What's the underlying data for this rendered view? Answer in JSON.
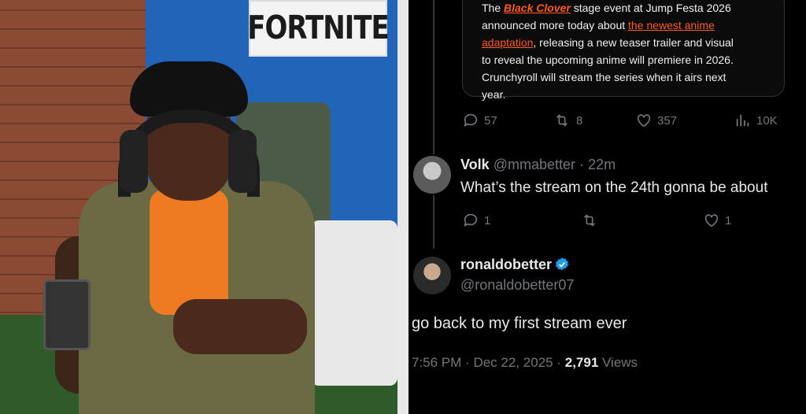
{
  "photo": {
    "banner_text": "FORTNITE"
  },
  "media_card": {
    "line1_pre": "The ",
    "line1_highlight": "Black Clover",
    "line1_post": " stage event at Jump Festa 2026",
    "line2_pre": "announced more today about ",
    "line2_link": "the newest anime",
    "line3_link": "adaptation",
    "line3_post": ", releasing a new teaser trailer and visual",
    "line4": "to reveal the upcoming anime will premiere in 2026.",
    "line5": "Crunchyroll will stream the series when it airs next",
    "line6": "year."
  },
  "tweet1_actions": {
    "replies": "57",
    "retweets": "8",
    "likes": "357",
    "views": "10K"
  },
  "reply": {
    "display_name": "Volk",
    "handle": "@mmabetter",
    "separator": "·",
    "time": "22m",
    "text": "What’s the stream on the 24th gonna be about",
    "replies": "1",
    "likes": "1"
  },
  "main_tweet": {
    "display_name": "ronaldobetter",
    "handle": "@ronaldobetter07",
    "text": "go back to my first stream ever",
    "time": "7:56 PM",
    "date": "Dec 22, 2025",
    "sep": "·",
    "views_count": "2,791",
    "views_label": "Views"
  },
  "colors": {
    "accent": "#1d9bf0",
    "card_link": "#ff5a1f"
  }
}
